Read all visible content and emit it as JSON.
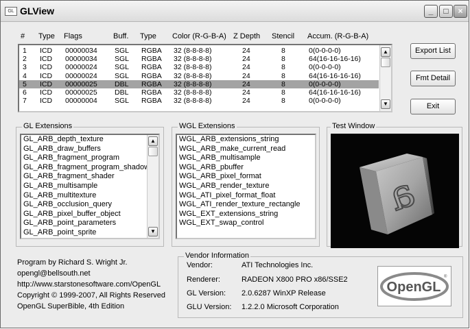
{
  "window": {
    "title": "GLView",
    "app_icon": "GL",
    "controls": {
      "minimize": "_",
      "maximize": "□",
      "close": "×"
    }
  },
  "pixel_formats": {
    "headers": [
      "#",
      "Type",
      "Flags",
      "Buff.",
      "Type",
      "Color (R-G-B-A)",
      "Z Depth",
      "Stencil",
      "Accum. (R-G-B-A)"
    ],
    "rows": [
      [
        "1",
        "ICD",
        "00000034",
        "SGL",
        "RGBA",
        "32 (8-8-8-8)",
        "24",
        "8",
        "0(0-0-0-0)"
      ],
      [
        "2",
        "ICD",
        "00000034",
        "SGL",
        "RGBA",
        "32 (8-8-8-8)",
        "24",
        "8",
        "64(16-16-16-16)"
      ],
      [
        "3",
        "ICD",
        "00000024",
        "SGL",
        "RGBA",
        "32 (8-8-8-8)",
        "24",
        "8",
        "0(0-0-0-0)"
      ],
      [
        "4",
        "ICD",
        "00000024",
        "SGL",
        "RGBA",
        "32 (8-8-8-8)",
        "24",
        "8",
        "64(16-16-16-16)"
      ],
      [
        "5",
        "ICD",
        "00000025",
        "DBL",
        "RGBA",
        "32 (8-8-8-8)",
        "24",
        "8",
        "0(0-0-0-0)"
      ],
      [
        "6",
        "ICD",
        "00000025",
        "DBL",
        "RGBA",
        "32 (8-8-8-8)",
        "24",
        "8",
        "64(16-16-16-16)"
      ],
      [
        "7",
        "ICD",
        "00000004",
        "SGL",
        "RGBA",
        "32 (8-8-8-8)",
        "24",
        "8",
        "0(0-0-0-0)"
      ]
    ],
    "selected_row": "5"
  },
  "buttons": {
    "export_list": "Export List",
    "fmt_detail": "Fmt Detail",
    "exit": "Exit"
  },
  "gl_extensions": {
    "label": "GL Extensions",
    "items": [
      "GL_ARB_depth_texture",
      "GL_ARB_draw_buffers",
      "GL_ARB_fragment_program",
      "GL_ARB_fragment_program_shadow",
      "GL_ARB_fragment_shader",
      "GL_ARB_multisample",
      "GL_ARB_multitexture",
      "GL_ARB_occlusion_query",
      "GL_ARB_pixel_buffer_object",
      "GL_ARB_point_parameters",
      "GL_ARB_point_sprite"
    ]
  },
  "wgl_extensions": {
    "label": "WGL Extensions",
    "items": [
      "WGL_ARB_extensions_string",
      "WGL_ARB_make_current_read",
      "WGL_ARB_multisample",
      "WGL_ARB_pbuffer",
      "WGL_ARB_pixel_format",
      "WGL_ARB_render_texture",
      "WGL_ATI_pixel_format_float",
      "WGL_ATI_render_texture_rectangle",
      "WGL_EXT_extensions_string",
      "WGL_EXT_swap_control"
    ]
  },
  "test_window": {
    "label": "Test Window",
    "cube_letter": "a"
  },
  "program_info": {
    "author": "Program by Richard S. Wright Jr.",
    "email": "opengl@bellsouth.net",
    "url": "http://www.starstonesoftware.com/OpenGL",
    "copyright": "Copyright © 1999-2007, All Rights Reserved",
    "book": "OpenGL SuperBible, 4th Edition"
  },
  "vendor_info": {
    "label": "Vendor Information",
    "rows": [
      {
        "key": "Vendor:",
        "value": "ATI Technologies Inc."
      },
      {
        "key": "Renderer:",
        "value": "RADEON X800 PRO x86/SSE2"
      },
      {
        "key": "GL Version:",
        "value": "2.0.6287 WinXP Release"
      },
      {
        "key": "GLU Version:",
        "value": "1.2.2.0 Microsoft Corporation"
      }
    ]
  },
  "logo": {
    "text": "OpenGL",
    "trademark": "®"
  },
  "scroll": {
    "up": "▲",
    "down": "▼"
  }
}
